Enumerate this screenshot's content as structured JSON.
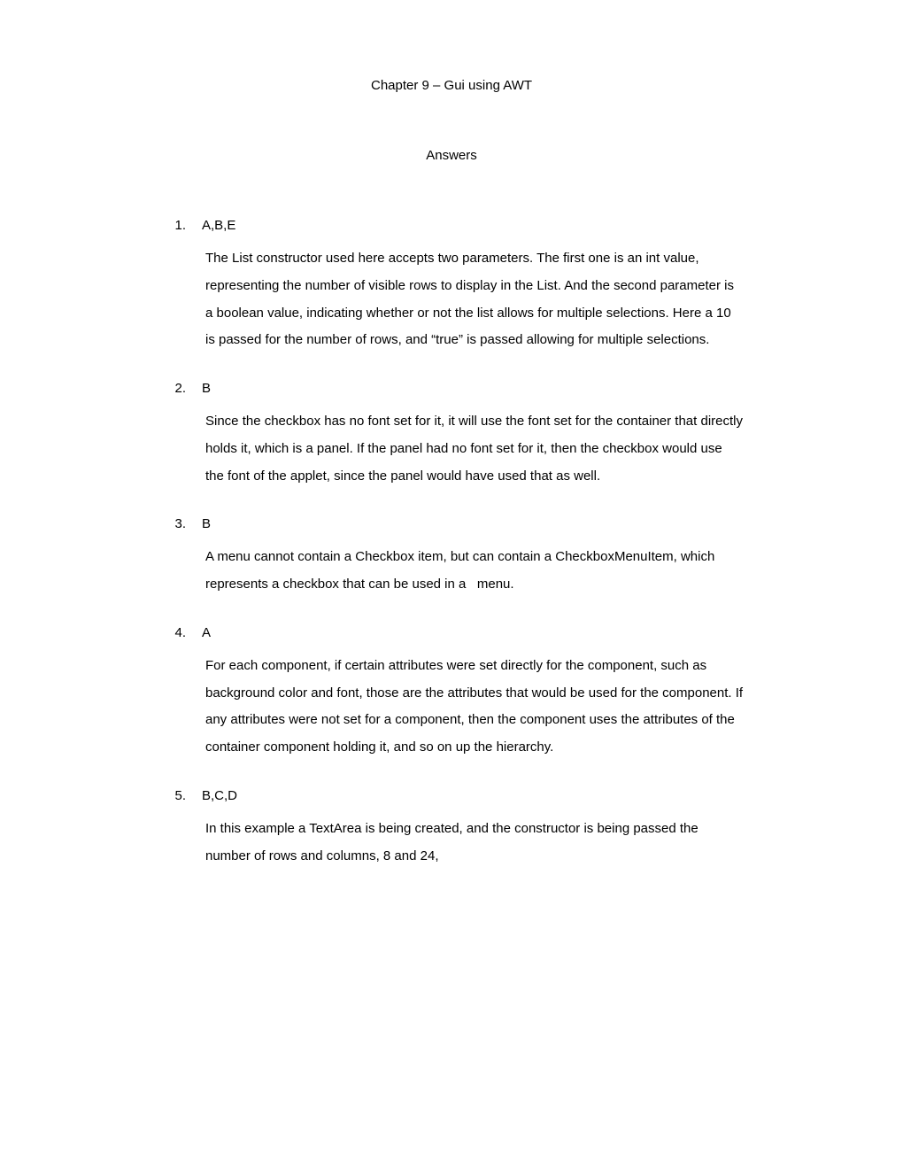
{
  "chapter_title": "Chapter 9 – Gui using AWT",
  "answers_heading": "Answers",
  "answers": [
    {
      "number": "1.",
      "code": "A,B,E",
      "text": "The List constructor used here accepts two parameters. The first one is an int value, representing the number of visible rows to display in the List. And the second parameter is a boolean value, indicating whether or not the list allows for multiple selections. Here a 10 is passed for the number of rows, and “true” is passed allowing for multiple selections."
    },
    {
      "number": "2.",
      "code": "B",
      "text": "Since the checkbox has no font set for it, it will use the font set for the container that directly holds it, which is a panel. If the panel had no font set for it, then the checkbox would use the font of the applet, since the panel would have used that as well."
    },
    {
      "number": "3.",
      "code": "B",
      "text": "A menu cannot contain a Checkbox item, but can contain a CheckboxMenuItem, which represents a checkbox that can be used in a   menu."
    },
    {
      "number": "4.",
      "code": "A",
      "text": "For each component, if certain attributes were set directly for the component, such as background color and font, those are the attributes that would be used for the component. If any attributes were not set for a component, then the component uses the attributes of the container component holding it, and so on up the hierarchy."
    },
    {
      "number": "5.",
      "code": "B,C,D",
      "text": "In this example a TextArea is being created, and the constructor is being passed the number of rows and columns, 8 and 24,"
    }
  ]
}
